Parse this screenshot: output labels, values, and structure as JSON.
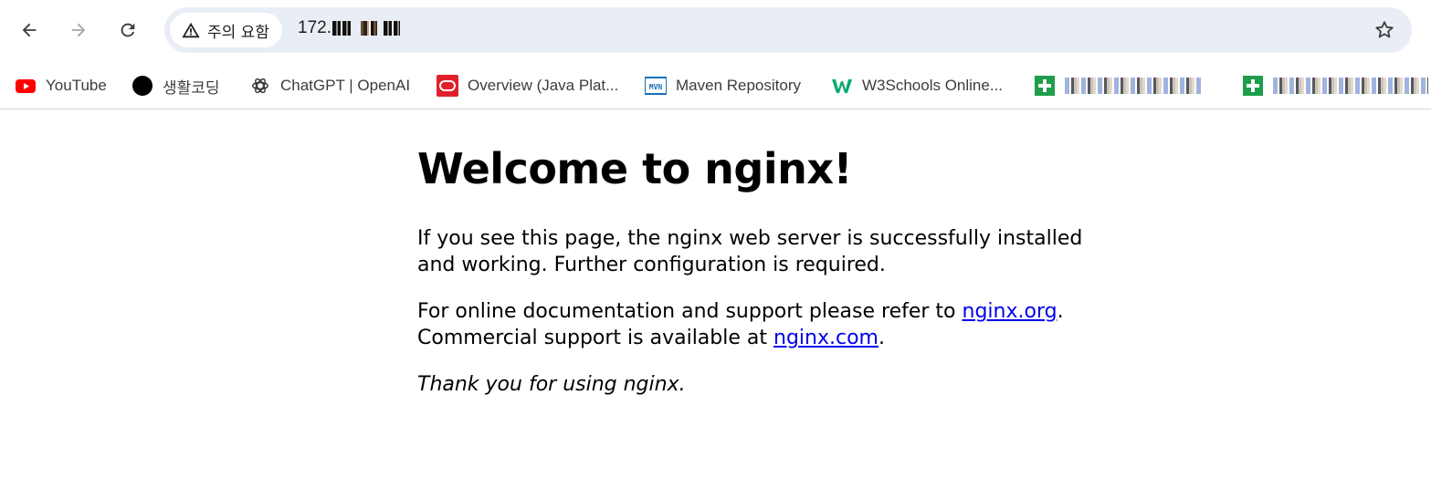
{
  "browser": {
    "security_chip_label": "주의 요함",
    "url_prefix": "172."
  },
  "bookmarks": [
    {
      "label": "YouTube",
      "icon": "youtube-icon"
    },
    {
      "label": "생활코딩",
      "icon": "black-circle-icon"
    },
    {
      "label": "ChatGPT | OpenAI",
      "icon": "openai-icon"
    },
    {
      "label": "Overview (Java Plat...",
      "icon": "oracle-icon"
    },
    {
      "label": "Maven Repository",
      "icon": "maven-icon"
    },
    {
      "label": "W3Schools Online...",
      "icon": "w3schools-icon"
    }
  ],
  "page": {
    "heading": "Welcome to nginx!",
    "para1": "If you see this page, the nginx web server is successfully installed and working. Further configuration is required.",
    "para2_before": "For online documentation and support please refer to ",
    "para2_link1": "nginx.org",
    "para2_mid": ".",
    "para2_line2": "Commercial support is available at ",
    "para2_link2": "nginx.com",
    "para2_end": ".",
    "para3": "Thank you for using nginx."
  },
  "colors": {
    "omnibox_bg": "#e9edf6",
    "link": "#0000ee",
    "youtube_red": "#ff0000",
    "oracle_red": "#e0202a",
    "maven_blue": "#1a6fb8",
    "w3_green": "#04aa6d",
    "sheets_green": "#1e9e4a"
  }
}
